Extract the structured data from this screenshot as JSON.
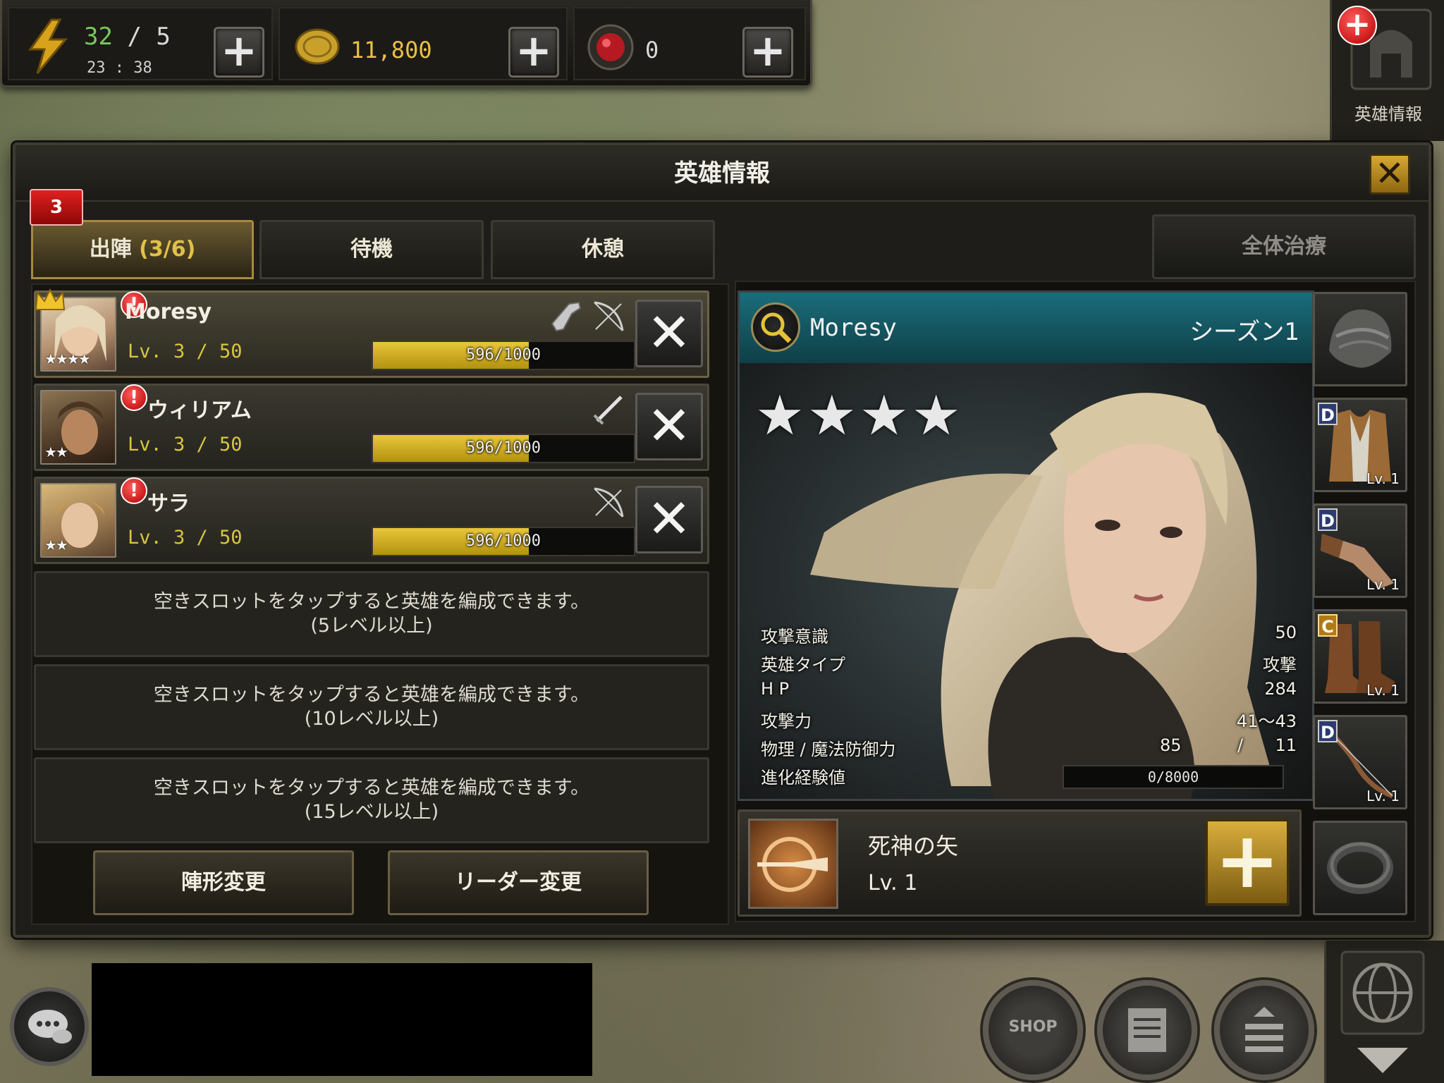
{
  "resources": {
    "stamina_current": "32",
    "stamina_separator": "/",
    "stamina_max": "5",
    "stamina_timer": "23 : 38",
    "gold": "11,800",
    "gems": "0"
  },
  "side": {
    "hero_info_label": "英雄情報"
  },
  "dialog": {
    "title": "英雄情報",
    "tabs": [
      {
        "label": "出陣",
        "count": "(3/6)",
        "badge": "3"
      },
      {
        "label": "待機"
      },
      {
        "label": "休憩"
      }
    ],
    "heal_all_label": "全体治療"
  },
  "heroes": [
    {
      "name": "Moresy",
      "level": "Lv.  3  /  50",
      "exp": "596/1000",
      "exp_ratio": 0.596,
      "stars": "★★★★",
      "leader": true,
      "weapons": [
        "gun-icon",
        "bow-icon"
      ]
    },
    {
      "name": "ウィリアム",
      "level": "Lv.  3  /  50",
      "exp": "596/1000",
      "exp_ratio": 0.596,
      "stars": "★★",
      "leader": false,
      "weapons": [
        "sword-icon"
      ]
    },
    {
      "name": "サラ",
      "level": "Lv.  3  /  50",
      "exp": "596/1000",
      "exp_ratio": 0.596,
      "stars": "★★",
      "leader": false,
      "weapons": [
        "bow-icon"
      ]
    }
  ],
  "empty_slots": [
    {
      "line1": "空きスロットをタップすると英雄を編成できます。",
      "line2": "(5レベル以上)"
    },
    {
      "line1": "空きスロットをタップすると英雄を編成できます。",
      "line2": "(10レベル以上)"
    },
    {
      "line1": "空きスロットをタップすると英雄を編成できます。",
      "line2": "(15レベル以上)"
    }
  ],
  "buttons": {
    "formation_change": "陣形変更",
    "leader_change": "リーダー変更"
  },
  "detail": {
    "name": "Moresy",
    "season": "シーズン1",
    "stars": "★★★★",
    "stats": [
      {
        "key": "攻撃意識",
        "value": "50"
      },
      {
        "key": "英雄タイプ",
        "value": "攻撃"
      },
      {
        "key": "H P",
        "value": "284"
      },
      {
        "key": "攻撃力",
        "value": "41～43"
      }
    ],
    "defense_label": "物理 / 魔法防御力",
    "phys_def": "85",
    "def_sep": "/",
    "magic_def": "11",
    "evolution_label": "進化経験値",
    "evolution_value": "0/8000",
    "evolution_ratio": 0
  },
  "equipment": [
    {
      "slot": "helmet",
      "grade": "",
      "level": ""
    },
    {
      "slot": "armor",
      "grade": "D",
      "level": "Lv. 1"
    },
    {
      "slot": "gloves",
      "grade": "D",
      "level": "Lv. 1"
    },
    {
      "slot": "boots",
      "grade": "C",
      "level": "Lv. 1"
    },
    {
      "slot": "bow",
      "grade": "D",
      "level": "Lv. 1"
    },
    {
      "slot": "ring",
      "grade": "",
      "level": ""
    }
  ],
  "skill": {
    "name": "死神の矢",
    "level": "Lv. 1"
  },
  "hud": {
    "shop_label": "SHOP"
  },
  "colors": {
    "accent_gold": "#d8b034",
    "teal_header": "#1a6d7a",
    "exp_yellow": "#e9c63a",
    "alert_red": "#d81010"
  }
}
